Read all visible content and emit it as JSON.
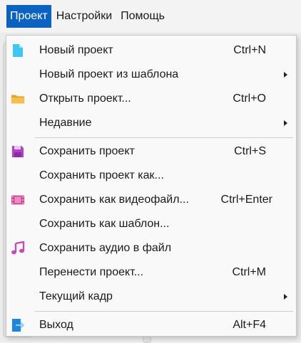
{
  "menubar": {
    "items": [
      {
        "label": "Проект"
      },
      {
        "label": "Настройки"
      },
      {
        "label": "Помощь"
      }
    ]
  },
  "menu": {
    "items": [
      {
        "label": "Новый проект",
        "shortcut": "Ctrl+N",
        "icon": "new-file-icon"
      },
      {
        "label": "Новый проект из шаблона",
        "shortcut": "",
        "submenu": true
      },
      {
        "label": "Открыть проект...",
        "shortcut": "Ctrl+O",
        "icon": "folder-icon"
      },
      {
        "label": "Недавние",
        "shortcut": "",
        "submenu": true
      },
      {
        "label": "Сохранить проект",
        "shortcut": "Ctrl+S",
        "icon": "floppy-icon"
      },
      {
        "label": "Сохранить проект как...",
        "shortcut": ""
      },
      {
        "label": "Сохранить как видеофайл...",
        "shortcut": "Ctrl+Enter",
        "icon": "film-icon"
      },
      {
        "label": "Сохранить как шаблон...",
        "shortcut": ""
      },
      {
        "label": "Сохранить аудио в файл",
        "shortcut": "",
        "icon": "music-icon"
      },
      {
        "label": "Перенести проект...",
        "shortcut": "Ctrl+M"
      },
      {
        "label": "Текущий кадр",
        "shortcut": "",
        "submenu": true
      },
      {
        "label": "Выход",
        "shortcut": "Alt+F4",
        "icon": "exit-icon"
      }
    ]
  },
  "colors": {
    "accent": "#0a63c3",
    "new_file": "#3ec6f0",
    "folder": "#f2b63c",
    "floppy": "#b042c9",
    "film": "#d0469a",
    "music": "#c64ab9",
    "exit": "#1f86e0"
  }
}
